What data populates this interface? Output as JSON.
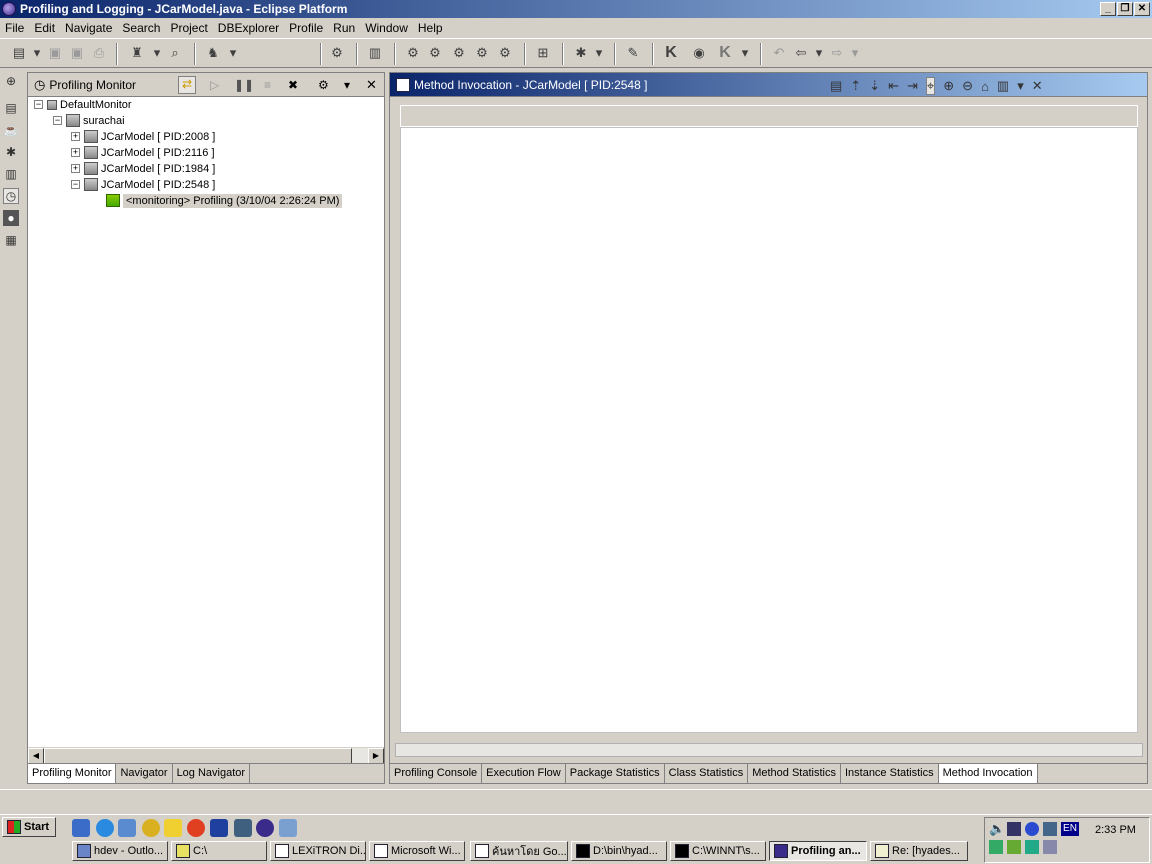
{
  "window": {
    "title": "Profiling and Logging - JCarModel.java - Eclipse Platform"
  },
  "menu": [
    "File",
    "Edit",
    "Navigate",
    "Search",
    "Project",
    "DBExplorer",
    "Profile",
    "Run",
    "Window",
    "Help"
  ],
  "profiling_monitor": {
    "title": "Profiling Monitor",
    "tree": {
      "root": "DefaultMonitor",
      "host": "surachai",
      "processes": [
        "JCarModel [ PID:2008 ]",
        "JCarModel [ PID:2116 ]",
        "JCarModel [ PID:1984 ]",
        "JCarModel [ PID:2548 ]"
      ],
      "agent": "<monitoring> Profiling (3/10/04 2:26:24 PM)"
    },
    "tabs": [
      "Profiling Monitor",
      "Navigator",
      "Log Navigator"
    ],
    "active_tab": "Profiling Monitor"
  },
  "method_invocation": {
    "title": "Method Invocation - JCarModel [ PID:2548 ]",
    "tabs": [
      "Profiling Console",
      "Execution Flow",
      "Package Statistics",
      "Class Statistics",
      "Method Statistics",
      "Instance Statistics",
      "Method Invocation"
    ],
    "active_tab": "Method Invocation"
  },
  "taskbar": {
    "start_label": "Start",
    "clock": "2:33 PM",
    "lang": "EN",
    "items": [
      "hdev - Outlo...",
      "C:\\",
      "LEXiTRON Di...",
      "Microsoft Wi...",
      "ค้นหาโดย Go...",
      "D:\\bin\\hyad...",
      "C:\\WINNT\\s...",
      "Profiling an...",
      "Re: [hyades..."
    ],
    "active_item": "Profiling an..."
  },
  "colors": {
    "title_start": "#0a246a",
    "title_end": "#a6caf0",
    "face": "#d4d0c8"
  }
}
